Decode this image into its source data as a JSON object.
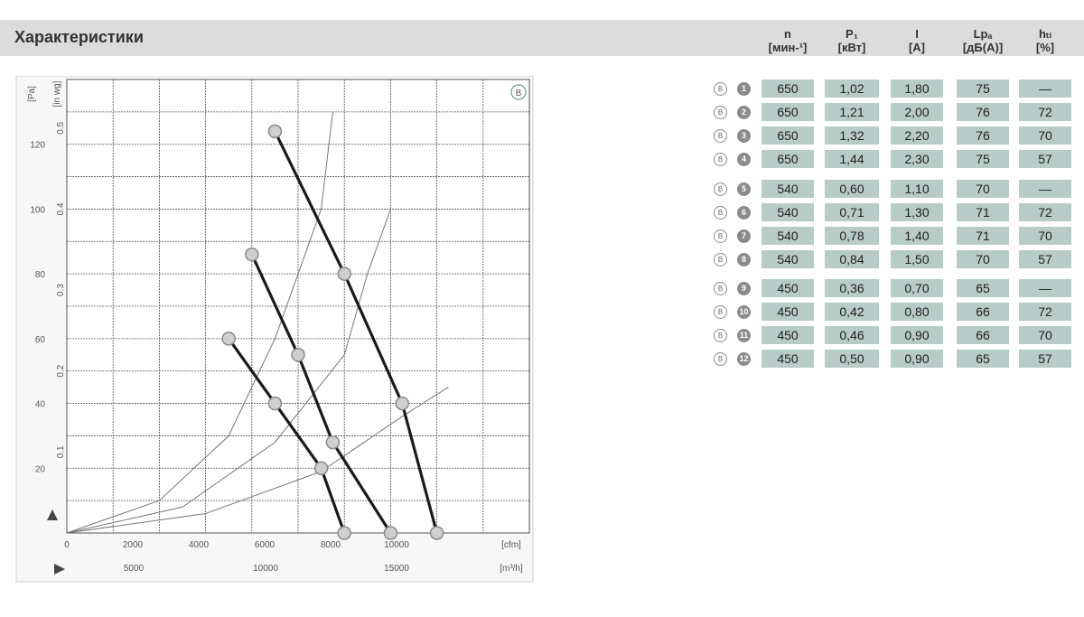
{
  "header": {
    "title": "Характеристики"
  },
  "table": {
    "columns": [
      {
        "symbol": "n",
        "unit": "[мин-¹]"
      },
      {
        "symbol": "P₁",
        "unit": "[кВт]"
      },
      {
        "symbol": "I",
        "unit": "[A]"
      },
      {
        "symbol": "Lpₐ",
        "unit": "[дБ(A)]"
      },
      {
        "symbol": "hₜₗ",
        "unit": "[%]"
      }
    ],
    "badge": "B",
    "rows": [
      {
        "id": "1",
        "n": "650",
        "p1": "1,02",
        "i": "1,80",
        "lpa": "75",
        "htl": "—"
      },
      {
        "id": "2",
        "n": "650",
        "p1": "1,21",
        "i": "2,00",
        "lpa": "76",
        "htl": "72"
      },
      {
        "id": "3",
        "n": "650",
        "p1": "1,32",
        "i": "2,20",
        "lpa": "76",
        "htl": "70"
      },
      {
        "id": "4",
        "n": "650",
        "p1": "1,44",
        "i": "2,30",
        "lpa": "75",
        "htl": "57"
      },
      {
        "id": "5",
        "n": "540",
        "p1": "0,60",
        "i": "1,10",
        "lpa": "70",
        "htl": "—"
      },
      {
        "id": "6",
        "n": "540",
        "p1": "0,71",
        "i": "1,30",
        "lpa": "71",
        "htl": "72"
      },
      {
        "id": "7",
        "n": "540",
        "p1": "0,78",
        "i": "1,40",
        "lpa": "71",
        "htl": "70"
      },
      {
        "id": "8",
        "n": "540",
        "p1": "0,84",
        "i": "1,50",
        "lpa": "70",
        "htl": "57"
      },
      {
        "id": "9",
        "n": "450",
        "p1": "0,36",
        "i": "0,70",
        "lpa": "65",
        "htl": "—"
      },
      {
        "id": "10",
        "n": "450",
        "p1": "0,42",
        "i": "0,80",
        "lpa": "66",
        "htl": "72"
      },
      {
        "id": "11",
        "n": "450",
        "p1": "0,46",
        "i": "0,90",
        "lpa": "66",
        "htl": "70"
      },
      {
        "id": "12",
        "n": "450",
        "p1": "0,50",
        "i": "0,90",
        "lpa": "65",
        "htl": "57"
      }
    ]
  },
  "chart_data": {
    "type": "line",
    "badge": "B",
    "x_unit": "[m³/h]",
    "x2_unit": "[cfm]",
    "y_unit": "[Pa]",
    "y2_unit": "[in wg]",
    "xlim": [
      0,
      20000
    ],
    "ylim": [
      0,
      140
    ],
    "x_ticks": [
      "0",
      "2000",
      "4000",
      "6000",
      "8000",
      "10000"
    ],
    "x_tick_values": [
      0,
      2000,
      4000,
      6000,
      8000,
      10000
    ],
    "x2_ticks": [
      "5000",
      "10000",
      "15000"
    ],
    "y_ticks": [
      "20",
      "40",
      "60",
      "80",
      "100",
      "120"
    ],
    "y_tick_values": [
      20,
      40,
      60,
      80,
      100,
      120
    ],
    "y2_ticks": [
      "0.1",
      "0.2",
      "0.3",
      "0.4",
      "0.5"
    ],
    "series": [
      {
        "points": [
          [
            7000,
            60
          ],
          [
            9000,
            40
          ],
          [
            11000,
            20
          ],
          [
            12000,
            0
          ]
        ]
      },
      {
        "points": [
          [
            8000,
            86
          ],
          [
            10000,
            55
          ],
          [
            11500,
            28
          ],
          [
            14000,
            0
          ]
        ]
      },
      {
        "points": [
          [
            9000,
            124
          ],
          [
            12000,
            80
          ],
          [
            14500,
            40
          ],
          [
            16000,
            0
          ]
        ]
      }
    ],
    "throttle_curves": [
      {
        "points": [
          [
            0,
            0
          ],
          [
            4000,
            10
          ],
          [
            7000,
            30
          ],
          [
            9000,
            60
          ],
          [
            11000,
            100
          ],
          [
            11500,
            130
          ]
        ]
      },
      {
        "points": [
          [
            0,
            0
          ],
          [
            5000,
            8
          ],
          [
            9000,
            28
          ],
          [
            12000,
            55
          ],
          [
            13000,
            80
          ],
          [
            14000,
            100
          ]
        ]
      },
      {
        "points": [
          [
            0,
            0
          ],
          [
            6000,
            6
          ],
          [
            11000,
            19
          ],
          [
            14500,
            36
          ],
          [
            16500,
            45
          ]
        ]
      }
    ]
  }
}
